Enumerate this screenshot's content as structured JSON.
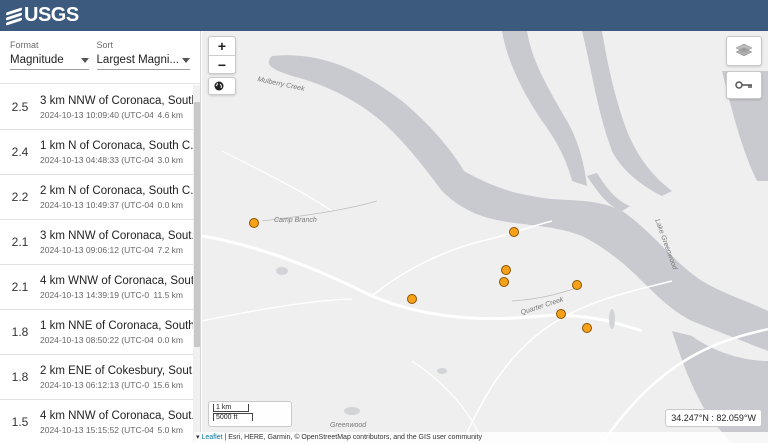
{
  "header": {
    "logo_text": "USGS"
  },
  "controls": {
    "format": {
      "label": "Format",
      "value": "Magnitude"
    },
    "sort": {
      "label": "Sort",
      "value": "Largest Magni..."
    }
  },
  "events": [
    {
      "mag": "2.5",
      "place": "3 km NNW of Coronaca, South",
      "time": "2024-10-13 10:09:40 (UTC-04:...",
      "depth": "4.6 km"
    },
    {
      "mag": "2.4",
      "place": "1 km N of Coronaca, South C...",
      "time": "2024-10-13 04:48:33 (UTC-04:...",
      "depth": "3.0 km"
    },
    {
      "mag": "2.2",
      "place": "2 km N of Coronaca, South C...",
      "time": "2024-10-13 10:49:37 (UTC-04:...",
      "depth": "0.0 km"
    },
    {
      "mag": "2.1",
      "place": "3 km NNW of Coronaca, Sout...",
      "time": "2024-10-13 09:06:12 (UTC-04:...",
      "depth": "7.2 km"
    },
    {
      "mag": "2.1",
      "place": "4 km WNW of Coronaca, Sout...",
      "time": "2024-10-13 14:39:19 (UTC-0...",
      "depth": "11.5 km"
    },
    {
      "mag": "1.8",
      "place": "1 km NNE of Coronaca, South...",
      "time": "2024-10-13 08:50:22 (UTC-04:...",
      "depth": "0.0 km"
    },
    {
      "mag": "1.8",
      "place": "2 km ENE of Cokesbury, Sout...",
      "time": "2024-10-13 06:12:13 (UTC-04:...",
      "depth": "15.6 km"
    },
    {
      "mag": "1.5",
      "place": "4 km NNW of Coronaca, Sout...",
      "time": "2024-10-13 15:15:52 (UTC-04:...",
      "depth": "5.0 km"
    }
  ],
  "map": {
    "zoom_in": "+",
    "zoom_out": "−",
    "labels": {
      "camp_branch": "Camp Branch",
      "mulberry_creek": "Mulberry Creek",
      "quarter_creek": "Quarter Creek",
      "greenwood": "Greenwood",
      "lake_greenwood": "Lake Greenwood"
    },
    "scale_km": "1 km",
    "scale_ft": "5000 ft",
    "coordinates": "34.247°N : 82.059°W",
    "attribution_leaflet": "Leaflet",
    "attribution_rest": " | Esri, HERE, Garmin, © OpenStreetMap contributors, and the GIS user community",
    "marker_color": "#f7a11a"
  }
}
